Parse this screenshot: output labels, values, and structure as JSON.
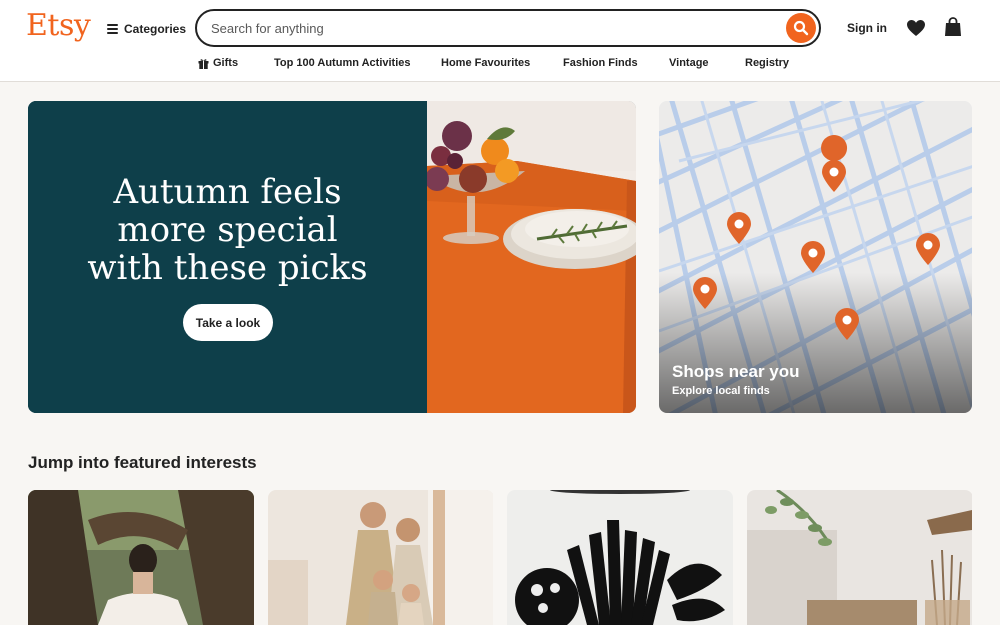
{
  "header": {
    "logo": "Etsy",
    "categories_label": "Categories",
    "search_placeholder": "Search for anything",
    "signin_label": "Sign in"
  },
  "nav": {
    "items": [
      "Gifts",
      "Top 100 Autumn Activities",
      "Home Favourites",
      "Fashion Finds",
      "Vintage",
      "Registry"
    ]
  },
  "hero": {
    "title_lines": [
      "Autumn feels",
      "more special",
      "with these picks"
    ],
    "button_label": "Take a look"
  },
  "shops": {
    "title": "Shops near you",
    "subtitle": "Explore local finds"
  },
  "featured": {
    "title": "Jump into featured interests"
  },
  "colors": {
    "brand": "#f1641e",
    "hero_bg": "#0e3f4a",
    "page_bg": "#f8f6f3"
  },
  "icons": [
    "hamburger-icon",
    "search-icon",
    "heart-icon",
    "shopping-bag-icon",
    "gift-icon",
    "map-pin-icon"
  ]
}
